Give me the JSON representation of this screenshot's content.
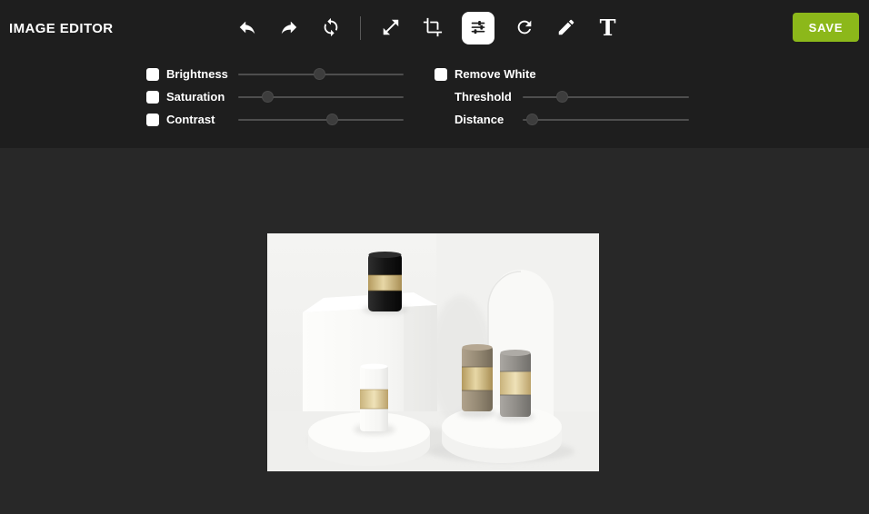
{
  "app": {
    "title": "IMAGE EDITOR"
  },
  "toolbar": {
    "tools": [
      {
        "name": "undo"
      },
      {
        "name": "redo"
      },
      {
        "name": "reset"
      },
      {
        "name": "resize"
      },
      {
        "name": "crop"
      },
      {
        "name": "adjustments",
        "active": true
      },
      {
        "name": "rotate"
      },
      {
        "name": "draw"
      },
      {
        "name": "text"
      }
    ],
    "text_tool_glyph": "T",
    "save_label": "SAVE",
    "save_color": "#8cb81a",
    "active_tool_bg": "#ffffff"
  },
  "controls": {
    "left_rows": [
      {
        "label": "Brightness",
        "checkbox": true,
        "checked": false,
        "value_pct": 49
      },
      {
        "label": "Saturation",
        "checkbox": true,
        "checked": false,
        "value_pct": 18
      },
      {
        "label": "Contrast",
        "checkbox": true,
        "checked": false,
        "value_pct": 57
      }
    ],
    "right_rows": [
      {
        "label": "Remove White",
        "checkbox": true,
        "checked": false
      },
      {
        "label": "Threshold",
        "checkbox": false,
        "value_pct": 24
      },
      {
        "label": "Distance",
        "checkbox": false,
        "value_pct": 6
      }
    ]
  },
  "canvas": {
    "background": "#282828",
    "panel_background": "#1e1e1e",
    "image": {
      "description": "Product photo: black, white, bronze and silver cosmetic jars with gold bands on white cube and round pedestals against a white arch backdrop"
    }
  }
}
